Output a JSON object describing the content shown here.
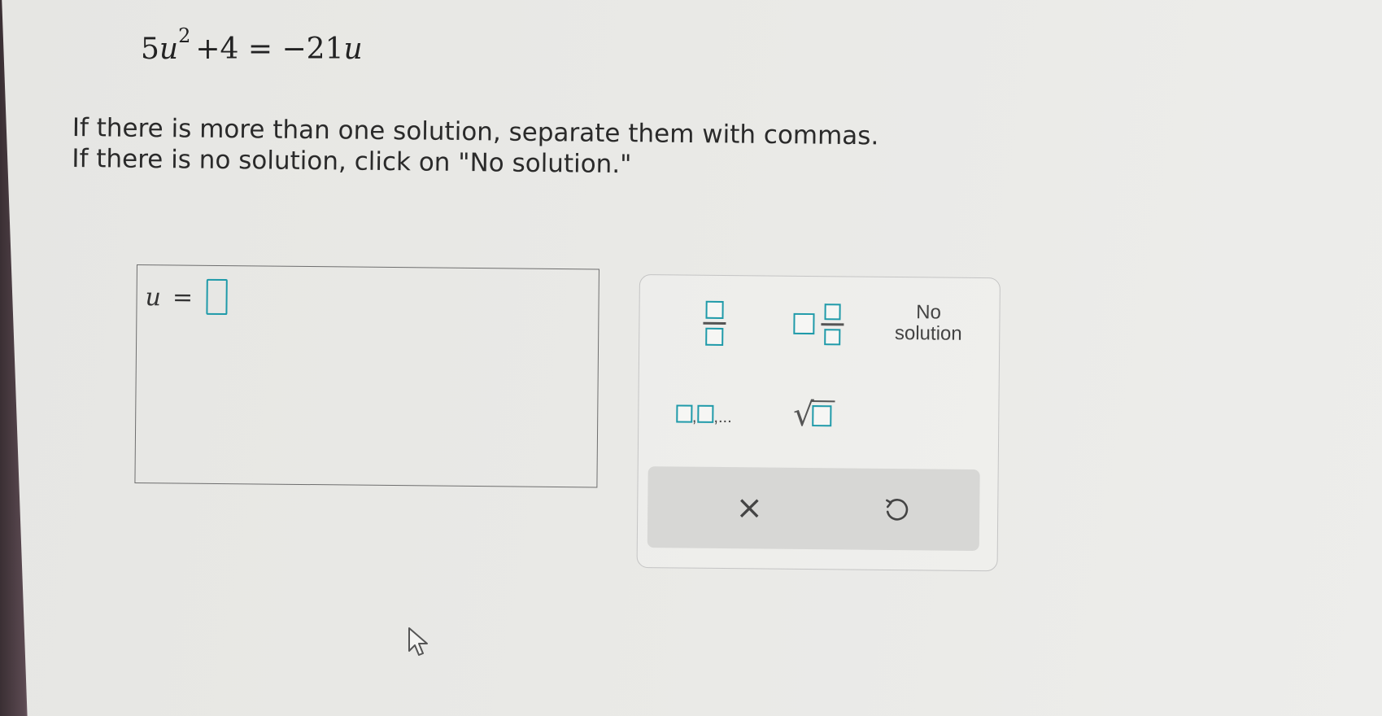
{
  "problem": {
    "equation": {
      "coef": "5",
      "var": "u",
      "exp": "2",
      "rest": "+4 = −21",
      "rhs_var": "u"
    },
    "instruction_line1": "If there is more than one solution, separate them with commas.",
    "instruction_line2": "If there is no solution, click on \"No solution.\""
  },
  "answer": {
    "variable": "u",
    "equals": "=",
    "value": ""
  },
  "keypad": {
    "fraction_icon": "fraction-template-icon",
    "mixed_number_icon": "mixed-number-template-icon",
    "no_solution_line1": "No",
    "no_solution_line2": "solution",
    "list_label": "□,□,...",
    "sqrt_icon": "square-root-template-icon",
    "clear_label": "×",
    "undo_icon": "undo-icon"
  },
  "colors": {
    "accent": "#1f9aa9",
    "background": "#e9e9e6",
    "action_bar": "#d7d7d5"
  }
}
